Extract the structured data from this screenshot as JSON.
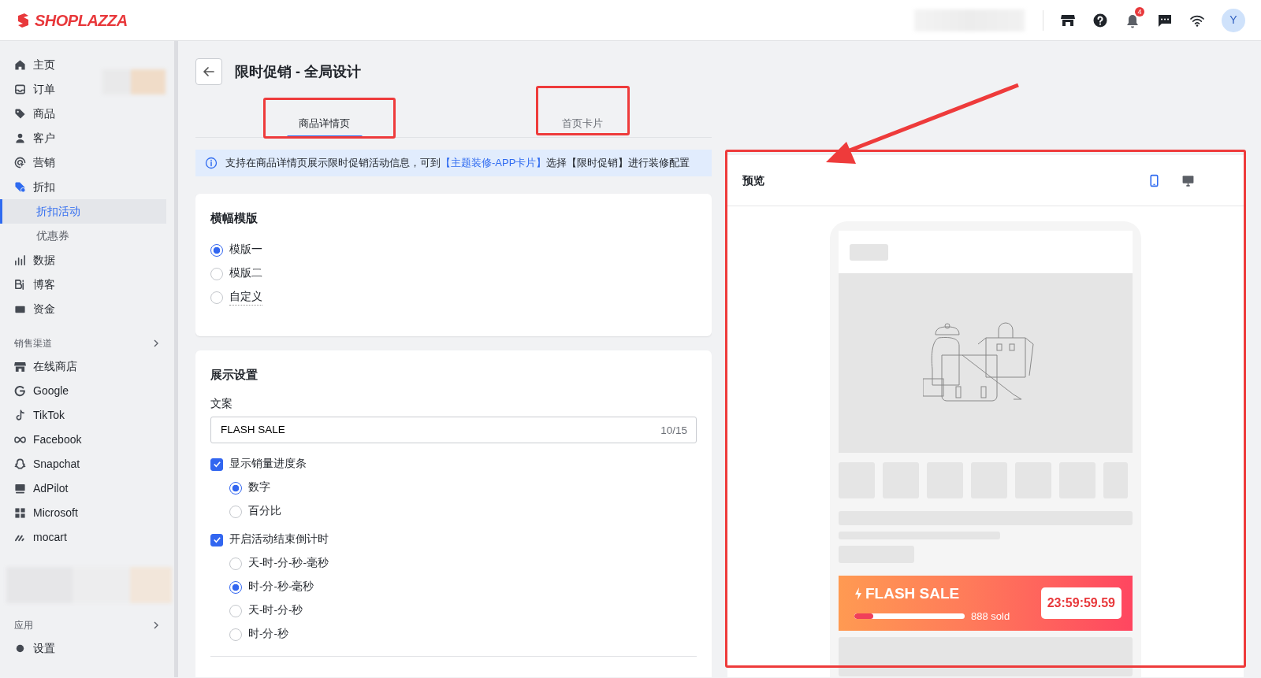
{
  "header": {
    "logo": "SHOPLAZZA",
    "notification_count": "4",
    "avatar": "Y"
  },
  "sidebar": {
    "groups": [
      {
        "items": [
          {
            "label": "主页",
            "selected": false
          },
          {
            "label": "订单",
            "selected": false
          },
          {
            "label": "商品",
            "selected": false
          },
          {
            "label": "客户",
            "selected": false
          },
          {
            "label": "营销",
            "selected": false
          },
          {
            "label": "折扣",
            "selected": false,
            "children": [
              {
                "label": "折扣活动",
                "selected": true
              },
              {
                "label": "优惠券",
                "selected": false
              }
            ]
          },
          {
            "label": "数据",
            "selected": false
          },
          {
            "label": "博客",
            "selected": false
          },
          {
            "label": "资金",
            "selected": false
          }
        ]
      },
      {
        "heading": "销售渠道",
        "items": [
          {
            "label": "在线商店",
            "selected": false
          },
          {
            "label": "Google",
            "selected": false
          },
          {
            "label": "TikTok",
            "selected": false
          },
          {
            "label": "Facebook",
            "selected": false
          },
          {
            "label": "Snapchat",
            "selected": false
          },
          {
            "label": "AdPilot",
            "selected": false
          },
          {
            "label": "Microsoft",
            "selected": false
          },
          {
            "label": "mocart",
            "selected": false
          }
        ]
      },
      {
        "heading": "应用"
      },
      {
        "items": [
          {
            "label": "设置",
            "selected": false
          }
        ]
      }
    ]
  },
  "page": {
    "title": "限时促销 - 全局设计",
    "tabs": [
      {
        "label": "商品详情页",
        "selected": true,
        "highlighted": true
      },
      {
        "label": "首页卡片",
        "selected": false,
        "highlighted": true
      }
    ],
    "info": {
      "text_before": "支持在商品详情页展示限时促销活动信息，可到",
      "link": "【主题装修-APP卡片】",
      "text_after": "选择【限时促销】进行装修配置"
    },
    "template_card": {
      "title": "横幅模版",
      "options": [
        {
          "label": "模版一",
          "selected": true,
          "has_tooltip": false
        },
        {
          "label": "模版二",
          "selected": false,
          "has_tooltip": false
        },
        {
          "label": "自定义",
          "selected": false,
          "has_tooltip": true
        }
      ]
    },
    "display_card": {
      "title": "展示设置",
      "copy_label": "文案",
      "copy_value": "FLASH SALE",
      "copy_counter": "10/15",
      "checks": [
        {
          "label": "显示销量进度条",
          "checked": true,
          "options": [
            {
              "label": "数字",
              "selected": true
            },
            {
              "label": "百分比",
              "selected": false
            }
          ]
        },
        {
          "label": "开启活动结束倒计时",
          "checked": true,
          "options": [
            {
              "label": "天-时-分-秒-毫秒",
              "selected": false
            },
            {
              "label": "时-分-秒-毫秒",
              "selected": true
            },
            {
              "label": "天-时-分-秒",
              "selected": false
            },
            {
              "label": "时-分-秒",
              "selected": false
            }
          ]
        }
      ]
    }
  },
  "preview": {
    "title": "预览",
    "highlighted": true,
    "pointer_arrow": true,
    "devices": [
      {
        "kind": "mobile",
        "selected": true
      },
      {
        "kind": "desktop",
        "selected": false
      }
    ],
    "flash_sale": {
      "title": "FLASH SALE",
      "level": 0.17,
      "sold": "888 sold",
      "timer": "23:59:59.59"
    }
  }
}
